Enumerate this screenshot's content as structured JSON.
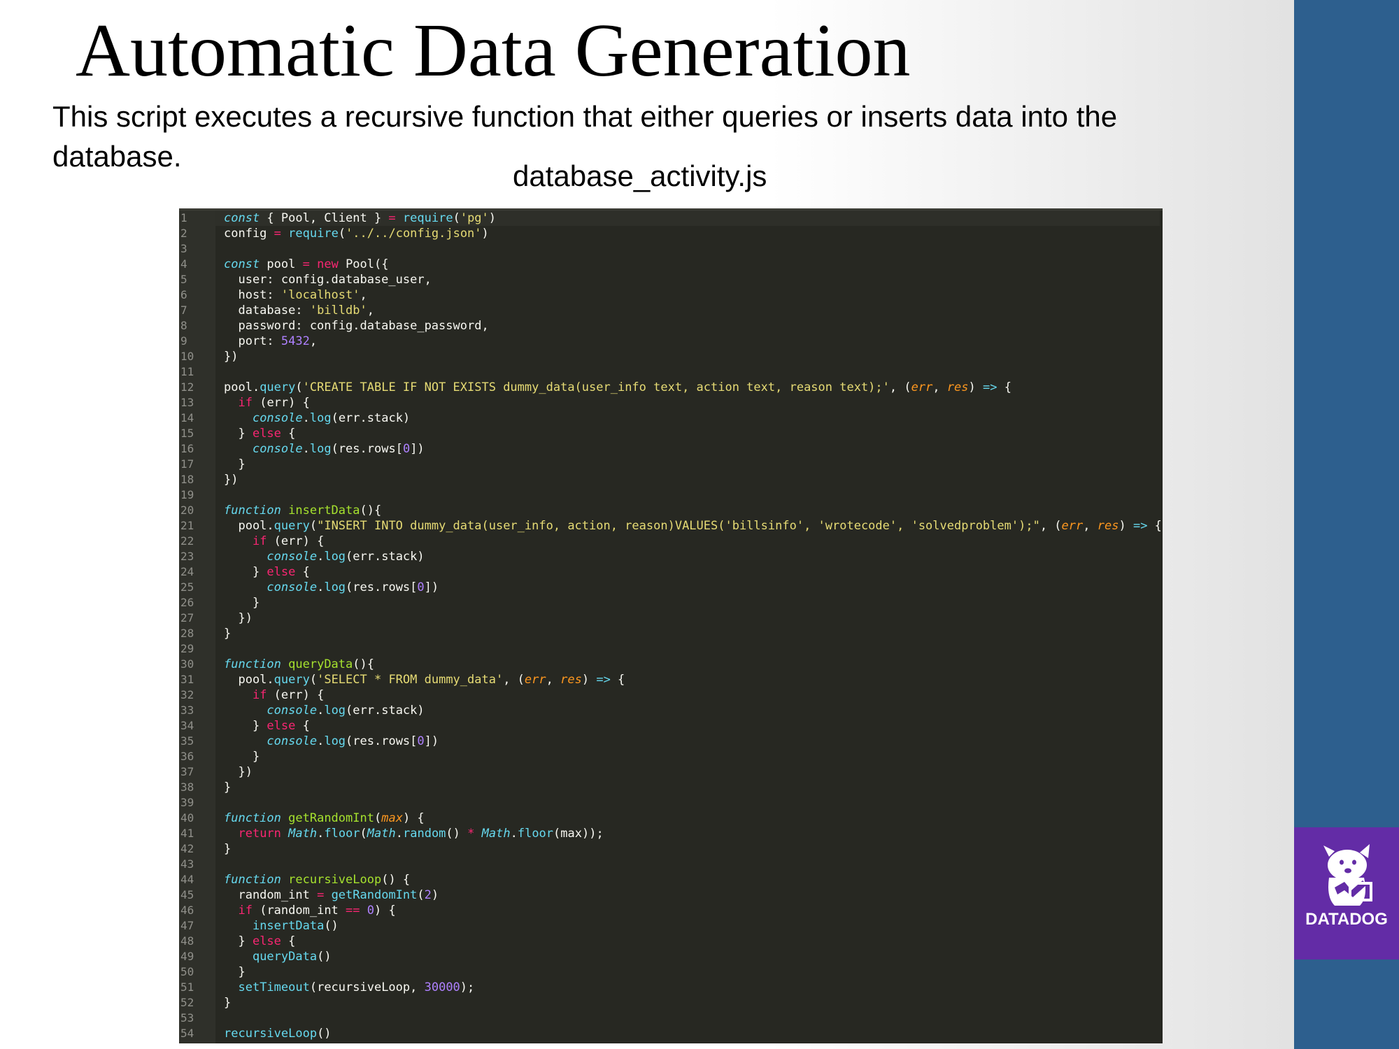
{
  "slide": {
    "title": "Automatic Data Generation",
    "description": "This script executes a recursive function that either queries or inserts data into the database.",
    "filename": "database_activity.js"
  },
  "logo": {
    "text": "DATADOG",
    "icon": "datadog-dog-icon"
  },
  "colors": {
    "sidebar": "#2d5f8e",
    "logo_bg": "#632ca6",
    "editor_bg": "#272822",
    "plain": "#f8f8f2",
    "keyword": "#f92672",
    "storage": "#66d9ef",
    "string": "#e6db74",
    "function": "#a6e22e",
    "number": "#ae81ff",
    "param": "#fd971f"
  },
  "code_lines": [
    {
      "n": "1",
      "t": [
        [
          "s",
          "const"
        ],
        [
          "p",
          " { Pool, Client } "
        ],
        [
          "k",
          "="
        ],
        [
          "p",
          " "
        ],
        [
          "c",
          "require"
        ],
        [
          "p",
          "("
        ],
        [
          "str",
          "'pg'"
        ],
        [
          "p",
          ")"
        ]
      ]
    },
    {
      "n": "2",
      "t": [
        [
          "p",
          "config "
        ],
        [
          "k",
          "="
        ],
        [
          "p",
          " "
        ],
        [
          "c",
          "require"
        ],
        [
          "p",
          "("
        ],
        [
          "str",
          "'../../config.json'"
        ],
        [
          "p",
          ")"
        ]
      ]
    },
    {
      "n": "3",
      "t": []
    },
    {
      "n": "4",
      "t": [
        [
          "s",
          "const"
        ],
        [
          "p",
          " pool "
        ],
        [
          "k",
          "="
        ],
        [
          "p",
          " "
        ],
        [
          "k",
          "new"
        ],
        [
          "p",
          " Pool({"
        ]
      ]
    },
    {
      "n": "5",
      "t": [
        [
          "p",
          "  user: config.database_user,"
        ]
      ]
    },
    {
      "n": "6",
      "t": [
        [
          "p",
          "  host: "
        ],
        [
          "str",
          "'localhost'"
        ],
        [
          "p",
          ","
        ]
      ]
    },
    {
      "n": "7",
      "t": [
        [
          "p",
          "  database: "
        ],
        [
          "str",
          "'billdb'"
        ],
        [
          "p",
          ","
        ]
      ]
    },
    {
      "n": "8",
      "t": [
        [
          "p",
          "  password: config.database_password,"
        ]
      ]
    },
    {
      "n": "9",
      "t": [
        [
          "p",
          "  port: "
        ],
        [
          "num",
          "5432"
        ],
        [
          "p",
          ","
        ]
      ]
    },
    {
      "n": "10",
      "t": [
        [
          "p",
          "})"
        ]
      ]
    },
    {
      "n": "11",
      "t": []
    },
    {
      "n": "12",
      "t": [
        [
          "p",
          "pool."
        ],
        [
          "c",
          "query"
        ],
        [
          "p",
          "("
        ],
        [
          "str",
          "'CREATE TABLE IF NOT EXISTS dummy_data(user_info text, action text, reason text);'"
        ],
        [
          "p",
          ", ("
        ],
        [
          "par",
          "err"
        ],
        [
          "p",
          ", "
        ],
        [
          "par",
          "res"
        ],
        [
          "p",
          ") "
        ],
        [
          "s",
          "=>"
        ],
        [
          "p",
          " {"
        ]
      ]
    },
    {
      "n": "13",
      "t": [
        [
          "p",
          "  "
        ],
        [
          "k",
          "if"
        ],
        [
          "p",
          " (err) {"
        ]
      ]
    },
    {
      "n": "14",
      "t": [
        [
          "p",
          "    "
        ],
        [
          "s",
          "console"
        ],
        [
          "p",
          "."
        ],
        [
          "c",
          "log"
        ],
        [
          "p",
          "(err.stack)"
        ]
      ]
    },
    {
      "n": "15",
      "t": [
        [
          "p",
          "  } "
        ],
        [
          "k",
          "else"
        ],
        [
          "p",
          " {"
        ]
      ]
    },
    {
      "n": "16",
      "t": [
        [
          "p",
          "    "
        ],
        [
          "s",
          "console"
        ],
        [
          "p",
          "."
        ],
        [
          "c",
          "log"
        ],
        [
          "p",
          "(res.rows["
        ],
        [
          "num",
          "0"
        ],
        [
          "p",
          "])"
        ]
      ]
    },
    {
      "n": "17",
      "t": [
        [
          "p",
          "  }"
        ]
      ]
    },
    {
      "n": "18",
      "t": [
        [
          "p",
          "})"
        ]
      ]
    },
    {
      "n": "19",
      "t": []
    },
    {
      "n": "20",
      "t": [
        [
          "s",
          "function"
        ],
        [
          "p",
          " "
        ],
        [
          "f",
          "insertData"
        ],
        [
          "p",
          "(){"
        ]
      ]
    },
    {
      "n": "21",
      "t": [
        [
          "p",
          "  pool."
        ],
        [
          "c",
          "query"
        ],
        [
          "p",
          "("
        ],
        [
          "str",
          "\"INSERT INTO dummy_data(user_info, action, reason)VALUES('billsinfo', 'wrotecode', 'solvedproblem');\""
        ],
        [
          "p",
          ", ("
        ],
        [
          "par",
          "err"
        ],
        [
          "p",
          ", "
        ],
        [
          "par",
          "res"
        ],
        [
          "p",
          ") "
        ],
        [
          "s",
          "=>"
        ],
        [
          "p",
          " {"
        ]
      ]
    },
    {
      "n": "22",
      "t": [
        [
          "p",
          "    "
        ],
        [
          "k",
          "if"
        ],
        [
          "p",
          " (err) {"
        ]
      ]
    },
    {
      "n": "23",
      "t": [
        [
          "p",
          "      "
        ],
        [
          "s",
          "console"
        ],
        [
          "p",
          "."
        ],
        [
          "c",
          "log"
        ],
        [
          "p",
          "(err.stack)"
        ]
      ]
    },
    {
      "n": "24",
      "t": [
        [
          "p",
          "    } "
        ],
        [
          "k",
          "else"
        ],
        [
          "p",
          " {"
        ]
      ]
    },
    {
      "n": "25",
      "t": [
        [
          "p",
          "      "
        ],
        [
          "s",
          "console"
        ],
        [
          "p",
          "."
        ],
        [
          "c",
          "log"
        ],
        [
          "p",
          "(res.rows["
        ],
        [
          "num",
          "0"
        ],
        [
          "p",
          "])"
        ]
      ]
    },
    {
      "n": "26",
      "t": [
        [
          "p",
          "    }"
        ]
      ]
    },
    {
      "n": "27",
      "t": [
        [
          "p",
          "  })"
        ]
      ]
    },
    {
      "n": "28",
      "t": [
        [
          "p",
          "}"
        ]
      ]
    },
    {
      "n": "29",
      "t": []
    },
    {
      "n": "30",
      "t": [
        [
          "s",
          "function"
        ],
        [
          "p",
          " "
        ],
        [
          "f",
          "queryData"
        ],
        [
          "p",
          "(){"
        ]
      ]
    },
    {
      "n": "31",
      "t": [
        [
          "p",
          "  pool."
        ],
        [
          "c",
          "query"
        ],
        [
          "p",
          "("
        ],
        [
          "str",
          "'SELECT * FROM dummy_data'"
        ],
        [
          "p",
          ", ("
        ],
        [
          "par",
          "err"
        ],
        [
          "p",
          ", "
        ],
        [
          "par",
          "res"
        ],
        [
          "p",
          ") "
        ],
        [
          "s",
          "=>"
        ],
        [
          "p",
          " {"
        ]
      ]
    },
    {
      "n": "32",
      "t": [
        [
          "p",
          "    "
        ],
        [
          "k",
          "if"
        ],
        [
          "p",
          " (err) {"
        ]
      ]
    },
    {
      "n": "33",
      "t": [
        [
          "p",
          "      "
        ],
        [
          "s",
          "console"
        ],
        [
          "p",
          "."
        ],
        [
          "c",
          "log"
        ],
        [
          "p",
          "(err.stack)"
        ]
      ]
    },
    {
      "n": "34",
      "t": [
        [
          "p",
          "    } "
        ],
        [
          "k",
          "else"
        ],
        [
          "p",
          " {"
        ]
      ]
    },
    {
      "n": "35",
      "t": [
        [
          "p",
          "      "
        ],
        [
          "s",
          "console"
        ],
        [
          "p",
          "."
        ],
        [
          "c",
          "log"
        ],
        [
          "p",
          "(res.rows["
        ],
        [
          "num",
          "0"
        ],
        [
          "p",
          "])"
        ]
      ]
    },
    {
      "n": "36",
      "t": [
        [
          "p",
          "    }"
        ]
      ]
    },
    {
      "n": "37",
      "t": [
        [
          "p",
          "  })"
        ]
      ]
    },
    {
      "n": "38",
      "t": [
        [
          "p",
          "}"
        ]
      ]
    },
    {
      "n": "39",
      "t": []
    },
    {
      "n": "40",
      "t": [
        [
          "s",
          "function"
        ],
        [
          "p",
          " "
        ],
        [
          "f",
          "getRandomInt"
        ],
        [
          "p",
          "("
        ],
        [
          "par",
          "max"
        ],
        [
          "p",
          ") {"
        ]
      ]
    },
    {
      "n": "41",
      "t": [
        [
          "p",
          "  "
        ],
        [
          "k",
          "return"
        ],
        [
          "p",
          " "
        ],
        [
          "s",
          "Math"
        ],
        [
          "p",
          "."
        ],
        [
          "c",
          "floor"
        ],
        [
          "p",
          "("
        ],
        [
          "s",
          "Math"
        ],
        [
          "p",
          "."
        ],
        [
          "c",
          "random"
        ],
        [
          "p",
          "() "
        ],
        [
          "k",
          "*"
        ],
        [
          "p",
          " "
        ],
        [
          "s",
          "Math"
        ],
        [
          "p",
          "."
        ],
        [
          "c",
          "floor"
        ],
        [
          "p",
          "(max));"
        ]
      ]
    },
    {
      "n": "42",
      "t": [
        [
          "p",
          "}"
        ]
      ]
    },
    {
      "n": "43",
      "t": []
    },
    {
      "n": "44",
      "t": [
        [
          "s",
          "function"
        ],
        [
          "p",
          " "
        ],
        [
          "f",
          "recursiveLoop"
        ],
        [
          "p",
          "() {"
        ]
      ]
    },
    {
      "n": "45",
      "t": [
        [
          "p",
          "  random_int "
        ],
        [
          "k",
          "="
        ],
        [
          "p",
          " "
        ],
        [
          "c",
          "getRandomInt"
        ],
        [
          "p",
          "("
        ],
        [
          "num",
          "2"
        ],
        [
          "p",
          ")"
        ]
      ]
    },
    {
      "n": "46",
      "t": [
        [
          "p",
          "  "
        ],
        [
          "k",
          "if"
        ],
        [
          "p",
          " (random_int "
        ],
        [
          "k",
          "=="
        ],
        [
          "p",
          " "
        ],
        [
          "num",
          "0"
        ],
        [
          "p",
          ") {"
        ]
      ]
    },
    {
      "n": "47",
      "t": [
        [
          "p",
          "    "
        ],
        [
          "c",
          "insertData"
        ],
        [
          "p",
          "()"
        ]
      ]
    },
    {
      "n": "48",
      "t": [
        [
          "p",
          "  } "
        ],
        [
          "k",
          "else"
        ],
        [
          "p",
          " {"
        ]
      ]
    },
    {
      "n": "49",
      "t": [
        [
          "p",
          "    "
        ],
        [
          "c",
          "queryData"
        ],
        [
          "p",
          "()"
        ]
      ]
    },
    {
      "n": "50",
      "t": [
        [
          "p",
          "  }"
        ]
      ]
    },
    {
      "n": "51",
      "t": [
        [
          "p",
          "  "
        ],
        [
          "c",
          "setTimeout"
        ],
        [
          "p",
          "(recursiveLoop, "
        ],
        [
          "num",
          "30000"
        ],
        [
          "p",
          ");"
        ]
      ]
    },
    {
      "n": "52",
      "t": [
        [
          "p",
          "}"
        ]
      ]
    },
    {
      "n": "53",
      "t": []
    },
    {
      "n": "54",
      "t": [
        [
          "c",
          "recursiveLoop"
        ],
        [
          "p",
          "()"
        ]
      ]
    }
  ]
}
